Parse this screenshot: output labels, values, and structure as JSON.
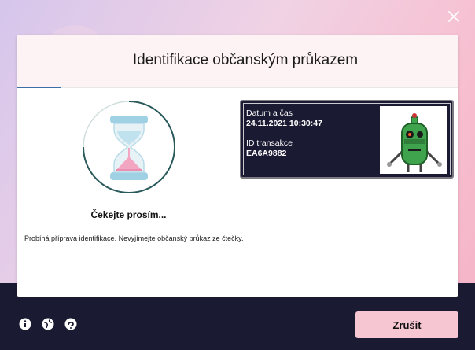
{
  "dialog": {
    "title": "Identifikace občanským průkazem",
    "progress": 0.1
  },
  "status": {
    "wait_label": "Čekejte prosím...",
    "message": "Probíhá příprava identifikace. Nevyjímejte občanský průkaz ze čtečky."
  },
  "transaction": {
    "date_label": "Datum a čas",
    "date_value": "24.11.2021 10:30:47",
    "id_label": "ID transakce",
    "id_value": "EA6A9882"
  },
  "footer": {
    "icons": [
      "info-icon",
      "globe-icon",
      "help-icon"
    ],
    "cancel_label": "Zrušit"
  },
  "colors": {
    "accent": "#3a6ea5",
    "cancel_button": "#f6c7d2",
    "dark_bg": "#1b1a33"
  }
}
